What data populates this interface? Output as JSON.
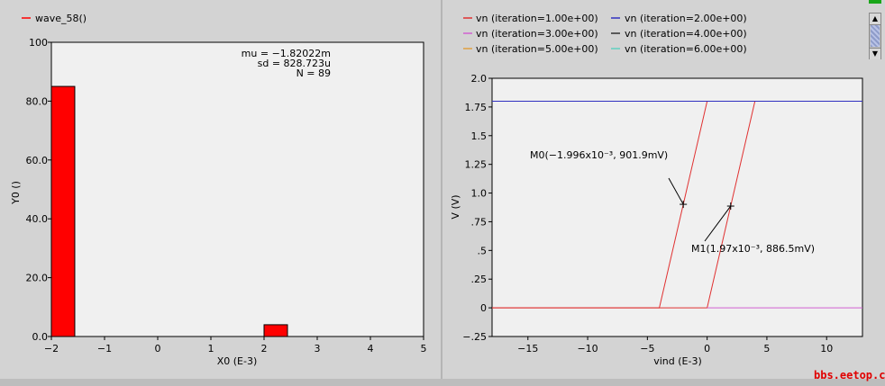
{
  "colors": {
    "wave_red": "#ff0000",
    "plot_bg": "#f0f0f0",
    "panel_bg": "#d3d3d3",
    "iter1": "#e03030",
    "iter2": "#3030c0",
    "iter3": "#d060d0",
    "iter4": "#303030",
    "iter5": "#e0a040",
    "iter6": "#60d0c0",
    "watermark": "#e00000"
  },
  "chart_data": [
    {
      "type": "bar",
      "legend": [
        "wave_58()"
      ],
      "xlabel": "X0 (E-3)",
      "ylabel": "Y0 ()",
      "xlim": [
        -2,
        5
      ],
      "ylim": [
        0,
        100
      ],
      "xticks": [
        "−2",
        "−1",
        "0",
        "1",
        "2",
        "3",
        "4",
        "5"
      ],
      "yticks": [
        "0.0",
        "20.0",
        "40.0",
        "60.0",
        "80.0",
        "100"
      ],
      "bins": [
        {
          "x0": -2.0,
          "x1": -1.56,
          "value": 85
        },
        {
          "x0": 2.0,
          "x1": 2.44,
          "value": 4
        }
      ],
      "stats": [
        "mu = −1.82022m",
        "sd = 828.723u",
        "N = 89"
      ]
    },
    {
      "type": "line",
      "xlabel": "vind (E-3)",
      "ylabel": "V (V)",
      "xlim": [
        -18,
        13
      ],
      "ylim": [
        -0.25,
        2.0
      ],
      "xticks": [
        "−15",
        "−10",
        "−5",
        "0",
        "5",
        "10"
      ],
      "yticks": [
        "2.0",
        "1.75",
        "1.5",
        "1.25",
        "1.0",
        ".75",
        ".5",
        ".25",
        "0",
        "−.25"
      ],
      "legend": [
        "vn (iteration=1.00e+00)",
        "vn (iteration=2.00e+00)",
        "vn (iteration=3.00e+00)",
        "vn (iteration=4.00e+00)",
        "vn (iteration=5.00e+00)",
        "vn (iteration=6.00e+00)"
      ],
      "series": [
        {
          "name": "vn (iteration=1.00e+00)",
          "x": [
            -18,
            -4.0,
            0.0,
            13
          ],
          "y": [
            0,
            0,
            1.8,
            1.8
          ]
        },
        {
          "name": "vn (iteration=1.00e+00)",
          "x": [
            -18,
            0.0,
            4.0
          ],
          "y": [
            0,
            0,
            1.8
          ]
        },
        {
          "name": "vn (iteration=2.00e+00)",
          "x": [
            -18,
            13
          ],
          "y": [
            1.8,
            1.8
          ]
        },
        {
          "name": "vn (iteration=3.00e+00)",
          "x": [
            0,
            13
          ],
          "y": [
            0,
            0
          ]
        }
      ],
      "markers": [
        {
          "label": "M0(−1.996x10⁻³, 901.9mV)",
          "x": -1.996,
          "y": 0.9019
        },
        {
          "label": "M1(1.97x10⁻³, 886.5mV)",
          "x": 1.97,
          "y": 0.8865
        }
      ]
    }
  ],
  "watermark": "bbs.eetop.cn"
}
